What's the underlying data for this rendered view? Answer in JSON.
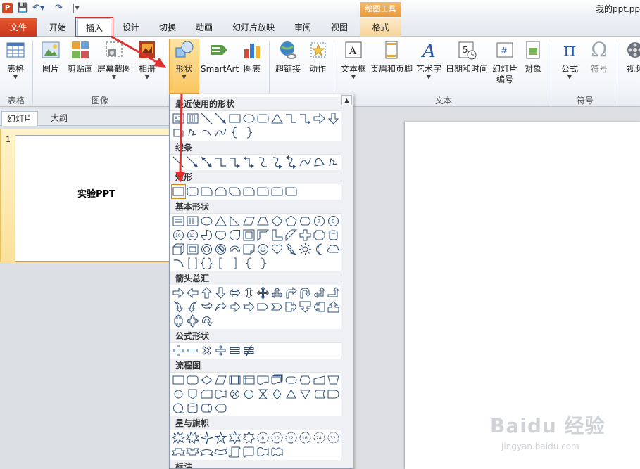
{
  "titlebar": {
    "app_icon": "P",
    "doc_title": "我的ppt.pp",
    "context_header": "绘图工具",
    "qat_icons": [
      "save-icon",
      "undo-icon",
      "redo-icon",
      "customize-icon"
    ]
  },
  "tabs": {
    "file": "文件",
    "items": [
      "开始",
      "插入",
      "设计",
      "切换",
      "动画",
      "幻灯片放映",
      "审阅",
      "视图",
      "格式"
    ],
    "active": "插入",
    "context": "格式"
  },
  "ribbon": {
    "buttons": {
      "table": "表格",
      "picture": "图片",
      "clipart": "剪贴画",
      "screenshot": "屏幕截图",
      "album": "相册",
      "shapes": "形状",
      "smartart": "SmartArt",
      "chart": "图表",
      "hyperlink": "超链接",
      "action": "动作",
      "textbox": "文本框",
      "header_footer": "页眉和页脚",
      "wordart": "艺术字",
      "datetime": "日期和时间",
      "slide_number_1": "幻灯片",
      "slide_number_2": "编号",
      "object": "对象",
      "equation": "公式",
      "symbol": "符号",
      "video": "视频"
    },
    "groups": {
      "tables": "表格",
      "images": "图像",
      "text": "文本",
      "symbols": "符号"
    }
  },
  "left_pane": {
    "tabs": [
      "幻灯片",
      "大纲"
    ],
    "active_tab": "幻灯片",
    "slide_number": "1",
    "slide_text": "实验PPT"
  },
  "shapes_menu": {
    "sections": [
      "最近使用的形状",
      "线条",
      "矩形",
      "基本形状",
      "箭头总汇",
      "公式形状",
      "流程图",
      "星与旗帜",
      "标注"
    ]
  },
  "watermark": {
    "brand": "Baidu 经验",
    "url": "jingyan.baidu.com"
  },
  "colors": {
    "file_tab": "#d2451f",
    "context_tab": "#f0a84b",
    "highlight_red": "#e02a2a",
    "pressed": "#fbc660"
  }
}
